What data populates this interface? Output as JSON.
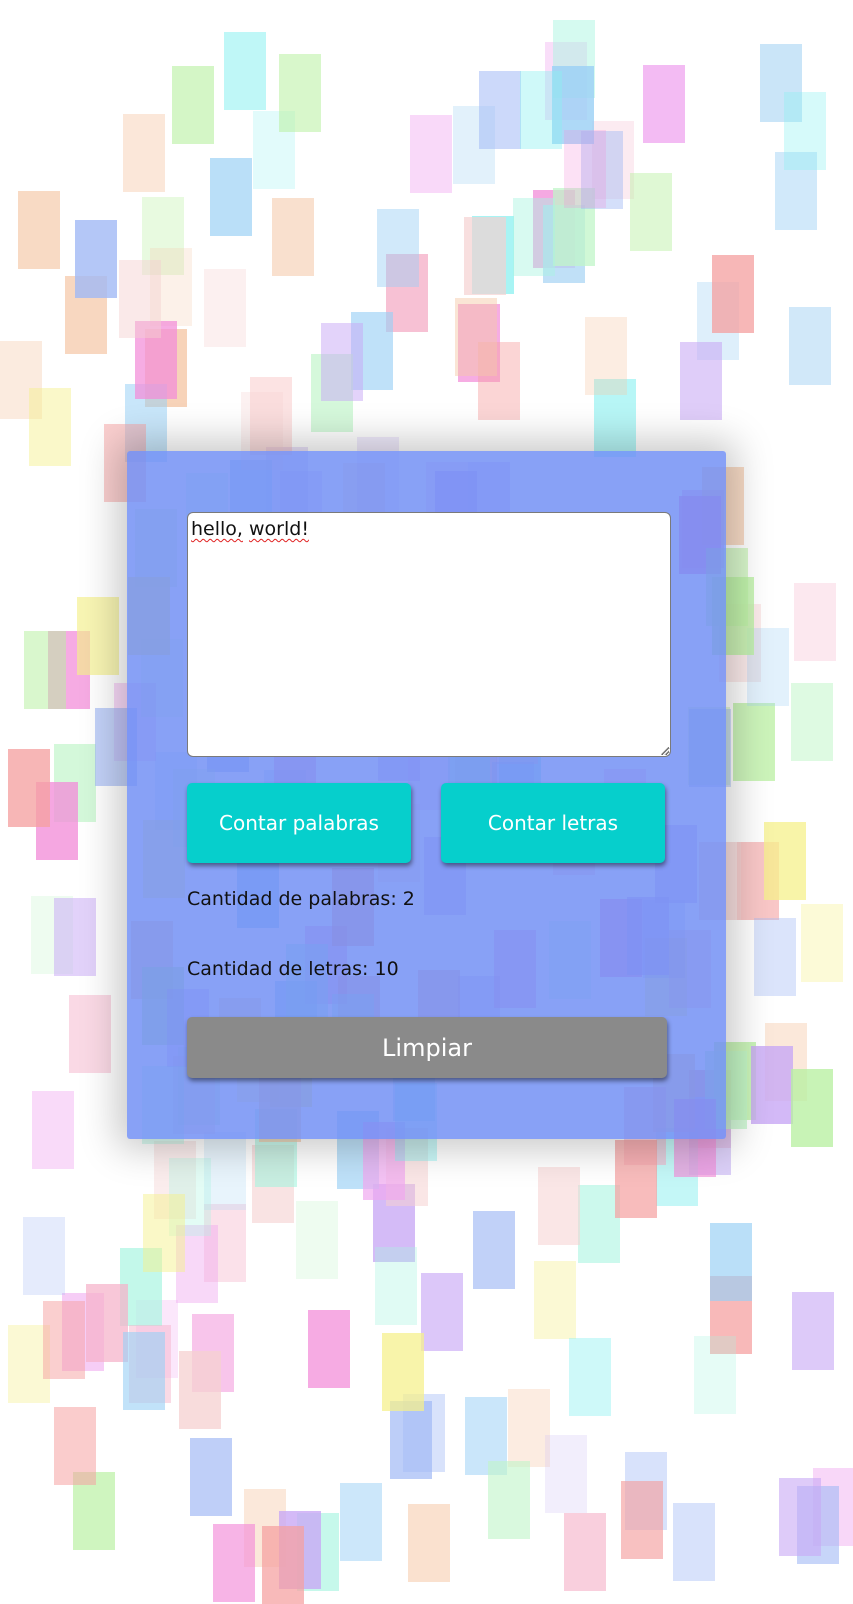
{
  "textarea": {
    "value_words": [
      "hello,",
      "world!"
    ]
  },
  "buttons": {
    "count_words": "Contar palabras",
    "count_letters": "Contar letras",
    "clear": "Limpiar"
  },
  "results": {
    "words": "Cantidad de palabras: 2",
    "letters": "Cantidad de letras: 10"
  },
  "colors": {
    "card": "#6e8cf4",
    "primary_button": "#06cfcc",
    "clear_button": "#8a8a8a"
  }
}
